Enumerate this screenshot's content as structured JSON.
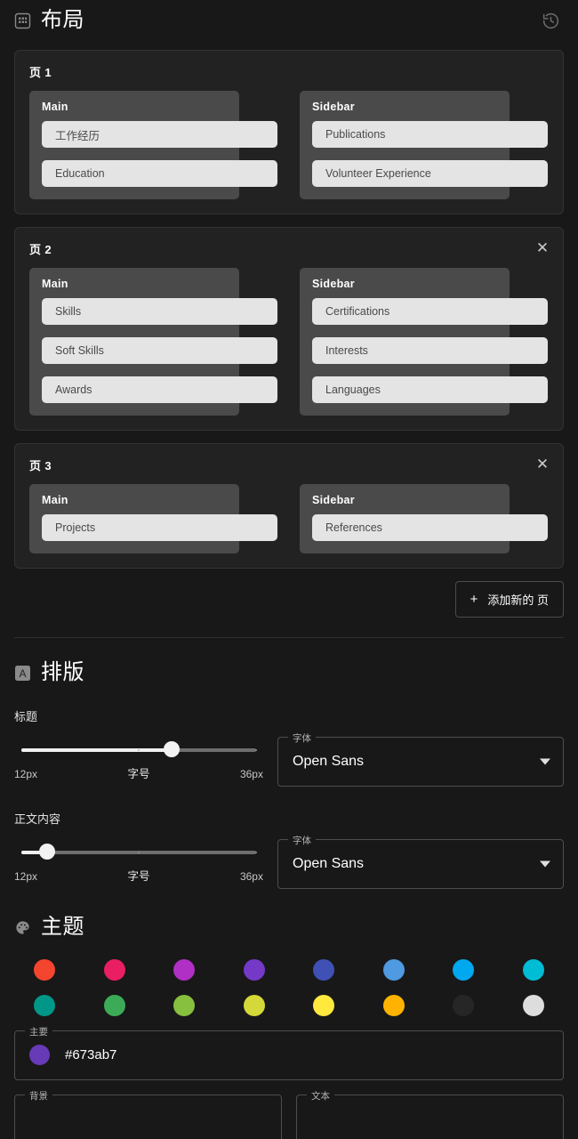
{
  "layout": {
    "icon": "dashboard-grid-icon",
    "title": "布局",
    "history_icon": "history-restore-icon",
    "add_page_label": "添加新的 页",
    "add_page_icon": "plus-icon",
    "close_icon": "close-icon",
    "pages": [
      {
        "label": "页 1",
        "closable": false,
        "columns": [
          {
            "title": "Main",
            "items": [
              "工作经历",
              "Education"
            ]
          },
          {
            "title": "Sidebar",
            "items": [
              "Publications",
              "Volunteer Experience"
            ]
          }
        ]
      },
      {
        "label": "页 2",
        "closable": true,
        "columns": [
          {
            "title": "Main",
            "items": [
              "Skills",
              "Soft Skills",
              "Awards"
            ]
          },
          {
            "title": "Sidebar",
            "items": [
              "Certifications",
              "Interests",
              "Languages"
            ]
          }
        ]
      },
      {
        "label": "页 3",
        "closable": true,
        "columns": [
          {
            "title": "Main",
            "items": [
              "Projects"
            ]
          },
          {
            "title": "Sidebar",
            "items": [
              "References"
            ]
          }
        ]
      }
    ]
  },
  "typography": {
    "icon": "letter-a-box-icon",
    "title": "排版",
    "groups": [
      {
        "label": "标题",
        "slider": {
          "min_label": "12px",
          "mid_label": "字号",
          "max_label": "36px",
          "min": 12,
          "max": 36,
          "value": 27,
          "percent": 64
        },
        "font_select": {
          "legend": "字体",
          "value": "Open Sans",
          "caret_icon": "chevron-down-icon"
        }
      },
      {
        "label": "正文内容",
        "slider": {
          "min_label": "12px",
          "mid_label": "字号",
          "max_label": "36px",
          "min": 12,
          "max": 36,
          "value": 15,
          "percent": 11
        },
        "font_select": {
          "legend": "字体",
          "value": "Open Sans",
          "caret_icon": "chevron-down-icon"
        }
      }
    ]
  },
  "theme": {
    "icon": "palette-icon",
    "title": "主题",
    "swatch_rows": [
      [
        "#f4452f",
        "#e91e63",
        "#b02fc4",
        "#7539c8",
        "#3f51b5",
        "#4f9ae0",
        "#00a8f0",
        "#00bcd4"
      ],
      [
        "#009688",
        "#3cab58",
        "#87bf3e",
        "#d4d838",
        "#ffe93d",
        "#ffb300",
        "#262626",
        "#dddddd"
      ]
    ],
    "primary_field": {
      "legend": "主要",
      "swatch": "#673ab7",
      "hex": "#673ab7"
    },
    "bottom_fields": [
      {
        "legend": "背景"
      },
      {
        "legend": "文本"
      }
    ]
  }
}
